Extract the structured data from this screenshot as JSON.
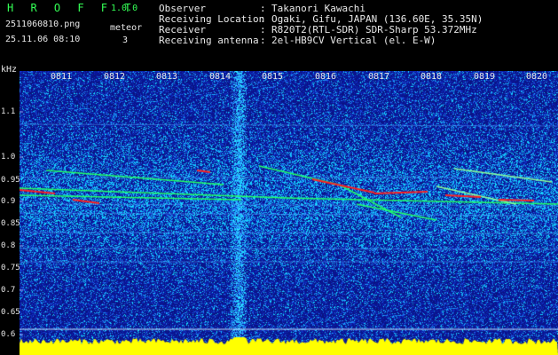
{
  "app": {
    "brand": "H R O F F T",
    "version": "1.0.0",
    "filename": "2511060810.png",
    "datetime": "25.11.06 08:10",
    "meteor_label": "meteor",
    "meteor_count": "3"
  },
  "info": [
    {
      "label": "Observer",
      "value": "Takanori Kawachi"
    },
    {
      "label": "Receiving Location",
      "value": "Ogaki, Gifu, JAPAN (136.60E, 35.35N)"
    },
    {
      "label": "Receiver",
      "value": "R820T2(RTL-SDR) SDR-Sharp 53.372MHz"
    },
    {
      "label": "Receiving antenna",
      "value": "2el-HB9CV Vertical (el. E-W)"
    }
  ],
  "info_separator": ":",
  "spectrogram": {
    "unit": "kHz",
    "x_labels": [
      "0811",
      "0812",
      "0813",
      "0814",
      "0815",
      "0816",
      "0817",
      "0818",
      "0819",
      "0820"
    ],
    "y_labels": [
      "1.1",
      "1.0",
      "0.95",
      "0.9",
      "0.85",
      "0.8",
      "0.75",
      "0.7",
      "0.65",
      "0.6"
    ],
    "colors": {
      "background": "#0a1a8c",
      "noise": "#2a5bff",
      "signal": "#ff2020",
      "trace": "#22ff66",
      "spectrum": "#ffff00",
      "label_green": "#33ff55"
    }
  }
}
